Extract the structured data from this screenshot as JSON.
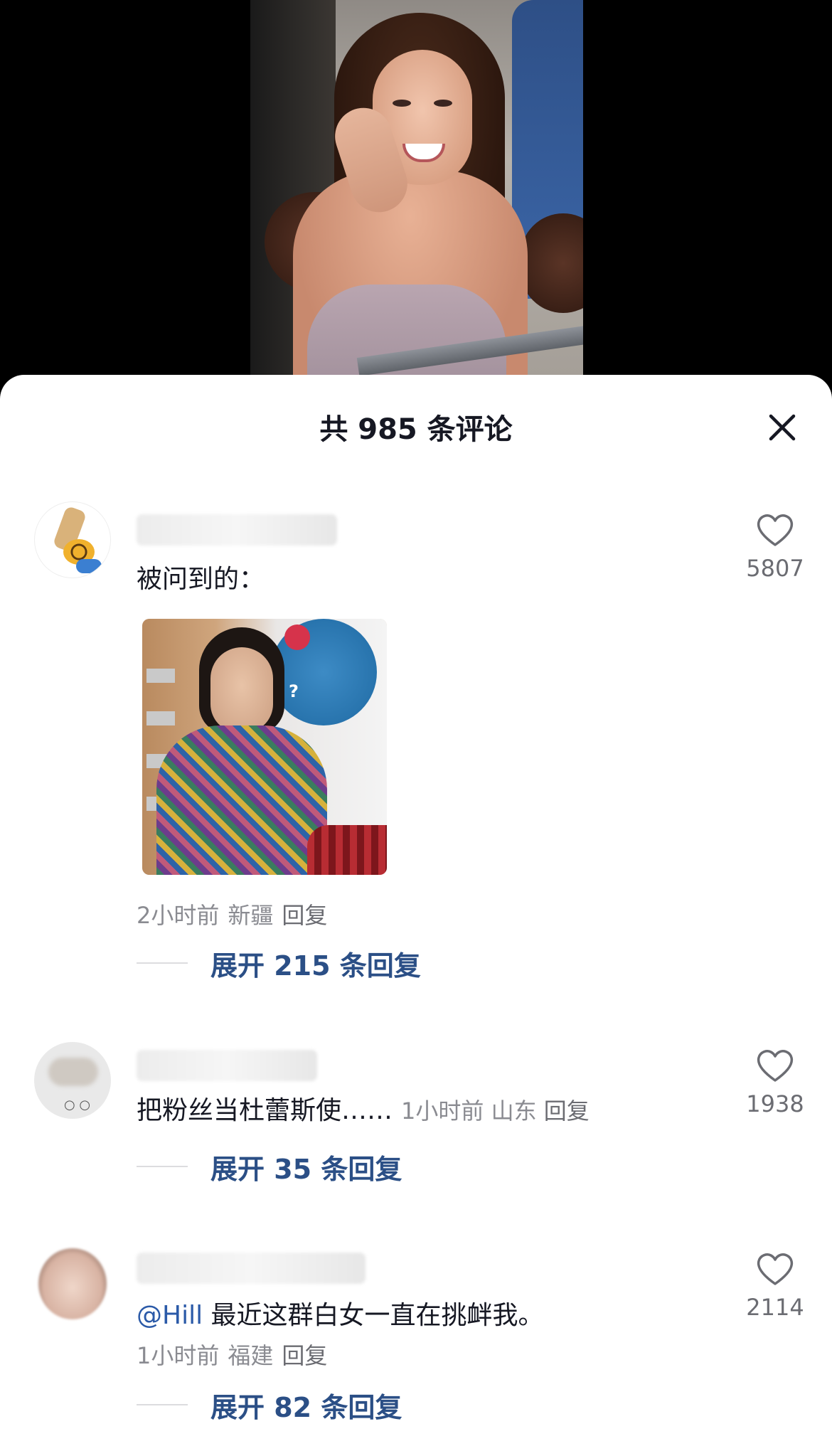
{
  "sheet": {
    "title": "共 985 条评论"
  },
  "comments": [
    {
      "text": "被问到的：",
      "time": "2小时前",
      "location": "新疆",
      "reply_label": "回复",
      "likes": "5807",
      "expand_label": "展开 215 条回复"
    },
    {
      "text": "把粉丝当杜蕾斯使……",
      "time": "1小时前",
      "location": "山东",
      "reply_label": "回复",
      "likes": "1938",
      "expand_label": "展开 35 条回复"
    },
    {
      "mention": "@Hill",
      "text": " 最近这群白女一直在挑衅我。",
      "time": "1小时前",
      "location": "福建",
      "reply_label": "回复",
      "likes": "2114",
      "expand_label": "展开 82 条回复"
    }
  ],
  "icons": {
    "close": "close-icon",
    "like": "heart-outline-icon"
  }
}
